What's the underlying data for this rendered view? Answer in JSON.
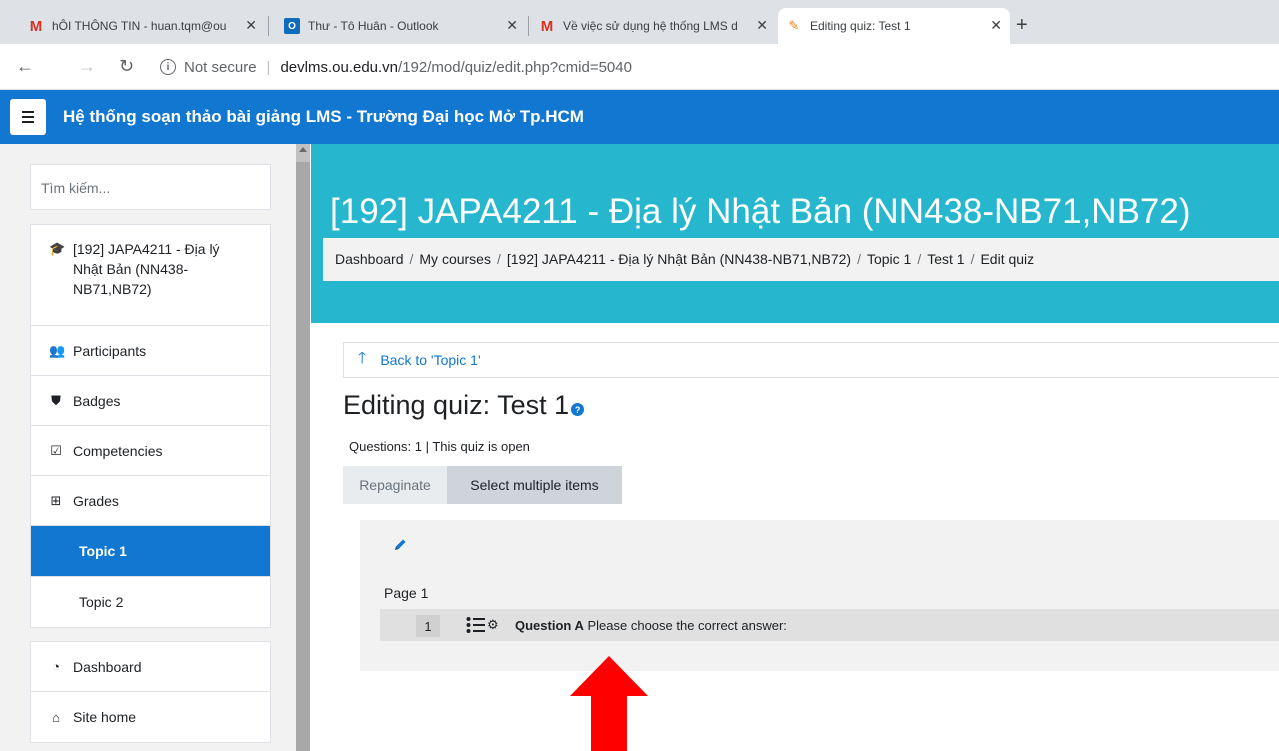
{
  "browser": {
    "tabs": [
      {
        "favicon": "gmail-icon",
        "title": "hÔI THÔNG TIN - huan.tqm@ou"
      },
      {
        "favicon": "outlook-icon",
        "title": "Thư - Tô Huân - Outlook"
      },
      {
        "favicon": "gmail-icon",
        "title": "Về việc sử dụng hệ thống LMS d"
      },
      {
        "favicon": "moodle-icon",
        "title": "Editing quiz: Test 1"
      }
    ],
    "address": {
      "security": "Not secure",
      "host": "devlms.ou.edu.vn",
      "path": "/192/mod/quiz/edit.php?cmid=5040"
    }
  },
  "navbar": {
    "site_title": "Hệ thống soạn thảo bài giảng LMS - Trường Đại học Mở Tp.HCM"
  },
  "drawer": {
    "search_placeholder": "Tìm kiếm...",
    "course_items": [
      {
        "icon": "graduation-cap-icon",
        "label": "[192] JAPA4211 - Địa lý Nhật Bản (NN438-NB71,NB72)"
      },
      {
        "icon": "users-icon",
        "label": "Participants"
      },
      {
        "icon": "shield-icon",
        "label": "Badges"
      },
      {
        "icon": "checkbox-icon",
        "label": "Competencies"
      },
      {
        "icon": "table-icon",
        "label": "Grades"
      },
      {
        "icon": "",
        "label": "Topic 1",
        "active": true
      },
      {
        "icon": "",
        "label": "Topic 2"
      }
    ],
    "site_items": [
      {
        "icon": "dashboard-icon",
        "label": "Dashboard"
      },
      {
        "icon": "home-icon",
        "label": "Site home"
      }
    ]
  },
  "header": {
    "course_title": "[192] JAPA4211 - Địa lý Nhật Bản (NN438-NB71,NB72)",
    "breadcrumb": [
      "Dashboard",
      "My courses",
      "[192] JAPA4211 - Địa lý Nhật Bản (NN438-NB71,NB72)",
      "Topic 1",
      "Test 1",
      "Edit quiz"
    ]
  },
  "main": {
    "back_link": "Back to 'Topic 1'",
    "heading": "Editing quiz: Test 1",
    "status": "Questions: 1 | This quiz is open",
    "buttons": {
      "repaginate": "Repaginate",
      "select_multiple": "Select multiple items"
    },
    "page_label": "Page 1",
    "question": {
      "number": "1",
      "name": "Question A",
      "text": "Please choose the correct answer:"
    }
  },
  "colors": {
    "navbar": "#1177d1",
    "header": "#26b6ce",
    "active_nav": "#1177d1",
    "annotation_arrow": "#ff0000"
  }
}
